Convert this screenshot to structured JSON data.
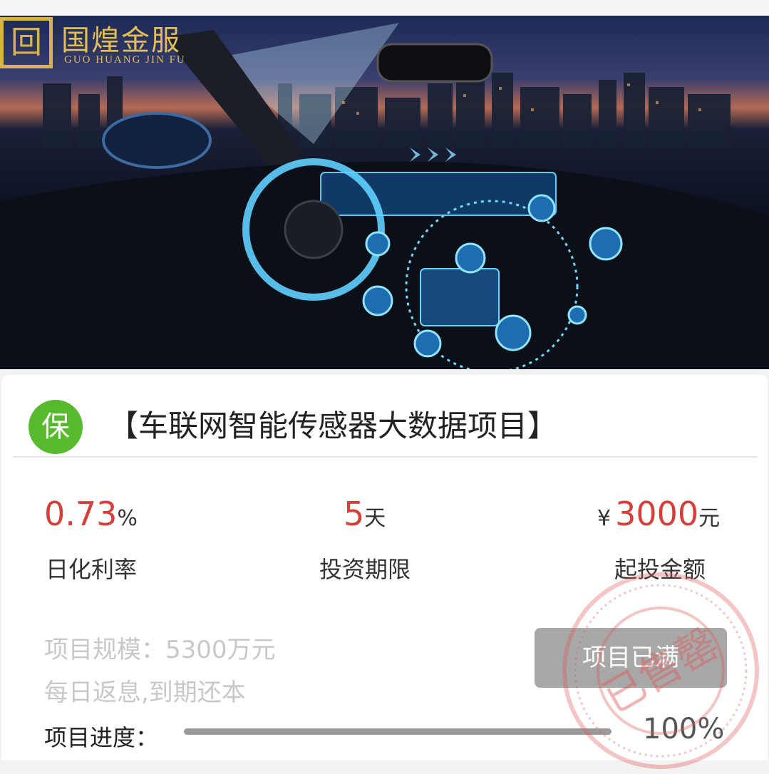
{
  "banner": {
    "logo_mark": "回",
    "logo_cn": "国煌金服",
    "logo_en": "GUO HUANG JIN FU"
  },
  "project": {
    "badge": "保",
    "title": "【车联网智能传感器大数据项目】"
  },
  "stats": {
    "rate_value": "0.73",
    "rate_unit": "%",
    "rate_label": "日化利率",
    "term_value": "5",
    "term_unit": "天",
    "term_label": "投资期限",
    "amount_currency": "¥",
    "amount_value": "3000",
    "amount_unit": "元",
    "amount_label": "起投金额"
  },
  "details": {
    "scale": "项目规模：5300万元",
    "repay": "每日返息,到期还本"
  },
  "action": {
    "button_label": "项目已满"
  },
  "progress": {
    "label": "项目进度：",
    "value_text": "100%",
    "fraction": 1.0
  },
  "stamp": {
    "text": "已售罄"
  },
  "colors": {
    "accent_red": "#d6403a",
    "badge_green": "#56b92e",
    "stamp_red": "#e05a5a",
    "logo_gold": "#d8b24a"
  }
}
